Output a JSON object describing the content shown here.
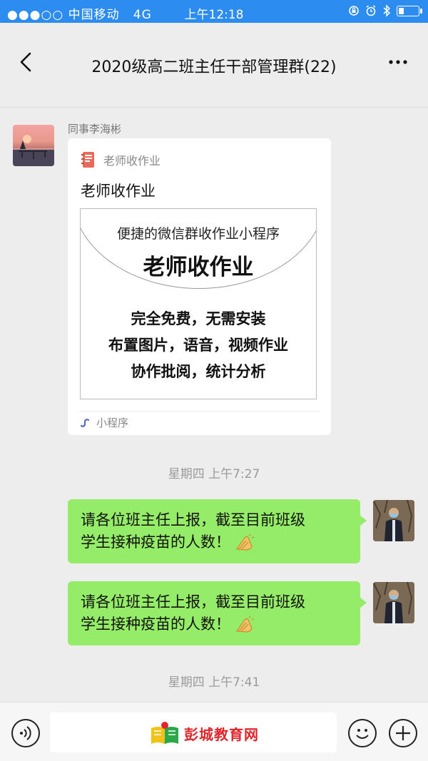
{
  "status": {
    "signal": "●●●○○",
    "carrier": "中国移动",
    "network": "4G",
    "time": "上午12:18"
  },
  "nav": {
    "title": "2020级高二班主任干部管理群(22)"
  },
  "message1": {
    "sender": "同事李海彬",
    "card": {
      "app_name": "老师收作业",
      "title": "老师收作业",
      "image_subtitle": "便捷的微信群收作业小程序",
      "image_title": "老师收作业",
      "image_lines": [
        "完全免费，无需安装",
        "布置图片，语音，视频作业",
        "协作批阅，统计分析"
      ],
      "footer": "小程序"
    }
  },
  "timestamps": [
    "星期四 上午7:27",
    "星期四 上午7:41"
  ],
  "bubbles": [
    {
      "line1": "请各位班主任上报，截至目前班级",
      "line2": "学生接种疫苗的人数！",
      "emoji": "clapping-hands-icon"
    },
    {
      "line1": "请各位班主任上报，截至目前班级",
      "line2": "学生接种疫苗的人数！",
      "emoji": "clapping-hands-icon"
    }
  ],
  "bottom": {
    "watermark": "彭城教育网"
  },
  "colors": {
    "statusbar": "#2d8cf0",
    "bubble": "#95ec69",
    "background": "#ededed",
    "watermark_red": "#e0262b"
  }
}
